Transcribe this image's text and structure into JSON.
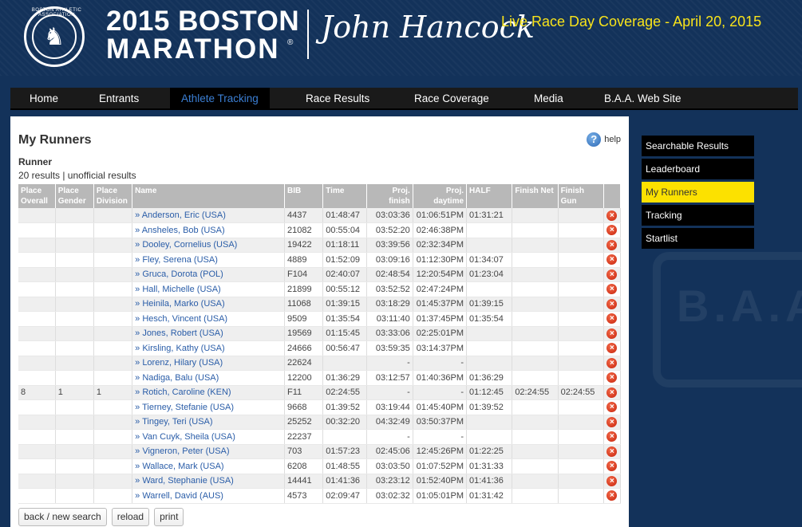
{
  "header": {
    "badge_text": "BOSTON ATHLETIC ASSOCIATION",
    "title_line1": "2015 BOSTON",
    "title_line2": "MARATHON",
    "registered_mark": "®",
    "sponsor": "John Hancock",
    "coverage": "Live Race Day Coverage - April 20, 2015"
  },
  "nav": {
    "items": [
      "Home",
      "Entrants",
      "Athlete Tracking",
      "Race Results",
      "Race Coverage",
      "Media",
      "B.A.A. Web Site"
    ],
    "active": "Athlete Tracking"
  },
  "main": {
    "title": "My Runners",
    "help_label": "help",
    "section_label": "Runner",
    "results_summary": "20 results | unofficial results",
    "columns": {
      "place_overall": "Place Overall",
      "place_gender": "Place Gender",
      "place_division": "Place Division",
      "name": "Name",
      "bib": "BIB",
      "time": "Time",
      "proj_finish": "Proj. finish",
      "proj_daytime": "Proj. daytime",
      "half": "HALF",
      "finish_net": "Finish Net",
      "finish_gun": "Finish Gun"
    },
    "rows": [
      {
        "po": "",
        "pg": "",
        "pd": "",
        "name": "» Anderson, Eric (USA)",
        "bib": "4437",
        "time": "01:48:47",
        "pf": "03:03:36",
        "pdt": "01:06:51PM",
        "half": "01:31:21",
        "fn": "",
        "fg": ""
      },
      {
        "po": "",
        "pg": "",
        "pd": "",
        "name": "» Ansheles, Bob (USA)",
        "bib": "21082",
        "time": "00:55:04",
        "pf": "03:52:20",
        "pdt": "02:46:38PM",
        "half": "",
        "fn": "",
        "fg": ""
      },
      {
        "po": "",
        "pg": "",
        "pd": "",
        "name": "» Dooley, Cornelius (USA)",
        "bib": "19422",
        "time": "01:18:11",
        "pf": "03:39:56",
        "pdt": "02:32:34PM",
        "half": "",
        "fn": "",
        "fg": ""
      },
      {
        "po": "",
        "pg": "",
        "pd": "",
        "name": "» Fley, Serena (USA)",
        "bib": "4889",
        "time": "01:52:09",
        "pf": "03:09:16",
        "pdt": "01:12:30PM",
        "half": "01:34:07",
        "fn": "",
        "fg": ""
      },
      {
        "po": "",
        "pg": "",
        "pd": "",
        "name": "» Gruca, Dorota (POL)",
        "bib": "F104",
        "time": "02:40:07",
        "pf": "02:48:54",
        "pdt": "12:20:54PM",
        "half": "01:23:04",
        "fn": "",
        "fg": ""
      },
      {
        "po": "",
        "pg": "",
        "pd": "",
        "name": "» Hall, Michelle (USA)",
        "bib": "21899",
        "time": "00:55:12",
        "pf": "03:52:52",
        "pdt": "02:47:24PM",
        "half": "",
        "fn": "",
        "fg": ""
      },
      {
        "po": "",
        "pg": "",
        "pd": "",
        "name": "» Heinila, Marko (USA)",
        "bib": "11068",
        "time": "01:39:15",
        "pf": "03:18:29",
        "pdt": "01:45:37PM",
        "half": "01:39:15",
        "fn": "",
        "fg": ""
      },
      {
        "po": "",
        "pg": "",
        "pd": "",
        "name": "» Hesch, Vincent (USA)",
        "bib": "9509",
        "time": "01:35:54",
        "pf": "03:11:40",
        "pdt": "01:37:45PM",
        "half": "01:35:54",
        "fn": "",
        "fg": ""
      },
      {
        "po": "",
        "pg": "",
        "pd": "",
        "name": "» Jones, Robert (USA)",
        "bib": "19569",
        "time": "01:15:45",
        "pf": "03:33:06",
        "pdt": "02:25:01PM",
        "half": "",
        "fn": "",
        "fg": ""
      },
      {
        "po": "",
        "pg": "",
        "pd": "",
        "name": "» Kirsling, Kathy (USA)",
        "bib": "24666",
        "time": "00:56:47",
        "pf": "03:59:35",
        "pdt": "03:14:37PM",
        "half": "",
        "fn": "",
        "fg": ""
      },
      {
        "po": "",
        "pg": "",
        "pd": "",
        "name": "» Lorenz, Hilary (USA)",
        "bib": "22624",
        "time": "",
        "pf": "-",
        "pdt": "-",
        "half": "",
        "fn": "",
        "fg": ""
      },
      {
        "po": "",
        "pg": "",
        "pd": "",
        "name": "» Nadiga, Balu (USA)",
        "bib": "12200",
        "time": "01:36:29",
        "pf": "03:12:57",
        "pdt": "01:40:36PM",
        "half": "01:36:29",
        "fn": "",
        "fg": ""
      },
      {
        "po": "8",
        "pg": "1",
        "pd": "1",
        "name": "» Rotich, Caroline (KEN)",
        "bib": "F11",
        "time": "02:24:55",
        "pf": "-",
        "pdt": "-",
        "half": "01:12:45",
        "fn": "02:24:55",
        "fg": "02:24:55"
      },
      {
        "po": "",
        "pg": "",
        "pd": "",
        "name": "» Tierney, Stefanie (USA)",
        "bib": "9668",
        "time": "01:39:52",
        "pf": "03:19:44",
        "pdt": "01:45:40PM",
        "half": "01:39:52",
        "fn": "",
        "fg": ""
      },
      {
        "po": "",
        "pg": "",
        "pd": "",
        "name": "» Tingey, Teri (USA)",
        "bib": "25252",
        "time": "00:32:20",
        "pf": "04:32:49",
        "pdt": "03:50:37PM",
        "half": "",
        "fn": "",
        "fg": ""
      },
      {
        "po": "",
        "pg": "",
        "pd": "",
        "name": "» Van Cuyk, Sheila (USA)",
        "bib": "22237",
        "time": "",
        "pf": "-",
        "pdt": "-",
        "half": "",
        "fn": "",
        "fg": ""
      },
      {
        "po": "",
        "pg": "",
        "pd": "",
        "name": "» Vigneron, Peter (USA)",
        "bib": "703",
        "time": "01:57:23",
        "pf": "02:45:06",
        "pdt": "12:45:26PM",
        "half": "01:22:25",
        "fn": "",
        "fg": ""
      },
      {
        "po": "",
        "pg": "",
        "pd": "",
        "name": "» Wallace, Mark (USA)",
        "bib": "6208",
        "time": "01:48:55",
        "pf": "03:03:50",
        "pdt": "01:07:52PM",
        "half": "01:31:33",
        "fn": "",
        "fg": ""
      },
      {
        "po": "",
        "pg": "",
        "pd": "",
        "name": "» Ward, Stephanie (USA)",
        "bib": "14441",
        "time": "01:41:36",
        "pf": "03:23:12",
        "pdt": "01:52:40PM",
        "half": "01:41:36",
        "fn": "",
        "fg": ""
      },
      {
        "po": "",
        "pg": "",
        "pd": "",
        "name": "» Warrell, David (AUS)",
        "bib": "4573",
        "time": "02:09:47",
        "pf": "03:02:32",
        "pdt": "01:05:01PM",
        "half": "01:31:42",
        "fn": "",
        "fg": ""
      }
    ],
    "buttons": {
      "back": "back / new search",
      "reload": "reload",
      "print": "print"
    }
  },
  "sidebar": {
    "items": [
      "Searchable Results",
      "Leaderboard",
      "My Runners",
      "Tracking",
      "Startlist"
    ],
    "active": "My Runners",
    "watermark": "B.A.A."
  },
  "colors": {
    "brand_navy": "#13325a",
    "headline_yellow": "#f8e31a",
    "active_sidebar": "#fce100",
    "link_blue": "#2a5da8",
    "remove_red": "#c8230b"
  },
  "icons": {
    "logo": "unicorn-badge-icon",
    "help": "help-icon",
    "remove": "remove-icon"
  }
}
